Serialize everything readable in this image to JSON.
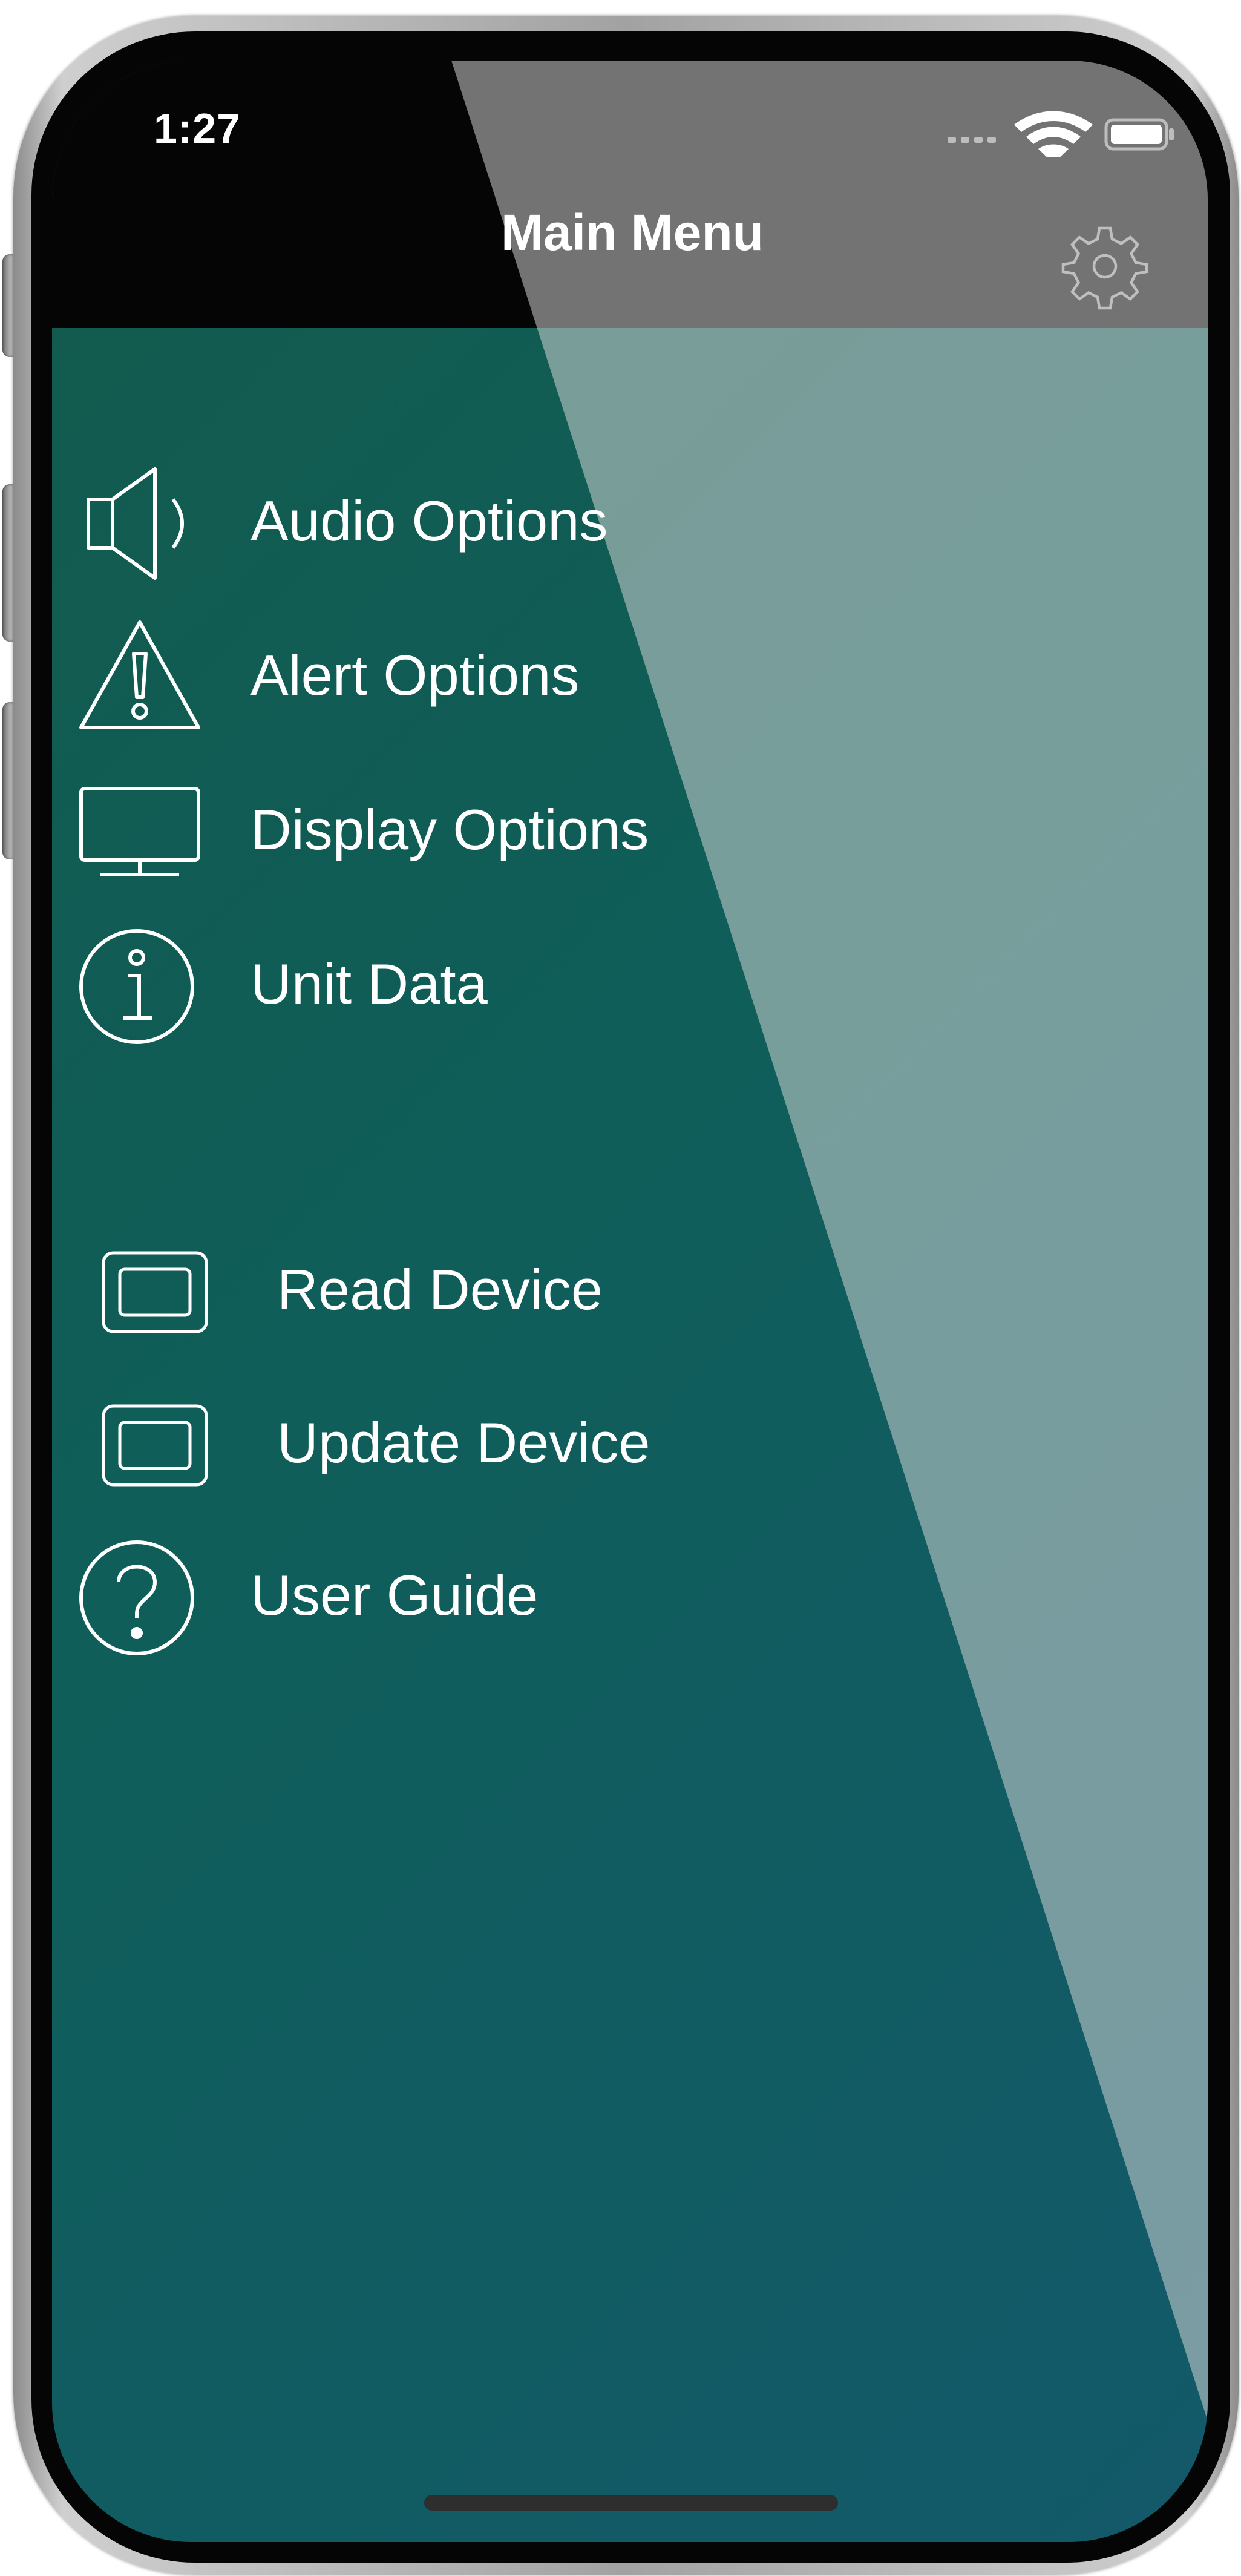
{
  "status_bar": {
    "time": "1:27",
    "icons": [
      "signal-dots-icon",
      "wifi-icon",
      "battery-icon"
    ]
  },
  "nav": {
    "title": "Main Menu",
    "settings_icon": "gear-icon"
  },
  "menu": {
    "group1": [
      {
        "label": "Audio Options",
        "icon": "speaker-icon"
      },
      {
        "label": "Alert Options",
        "icon": "warning-triangle-icon"
      },
      {
        "label": "Display Options",
        "icon": "monitor-icon"
      },
      {
        "label": "Unit Data",
        "icon": "info-circle-icon"
      }
    ],
    "group2": [
      {
        "label": "Read Device",
        "icon": "device-icon"
      },
      {
        "label": "Update Device",
        "icon": "device-icon"
      },
      {
        "label": "User Guide",
        "icon": "help-circle-icon"
      }
    ]
  },
  "colors": {
    "background_start": "#135a4c",
    "background_end": "#13596a",
    "overlay": "#bfd6da",
    "nav_bar": "#050505",
    "text": "#ffffff"
  }
}
